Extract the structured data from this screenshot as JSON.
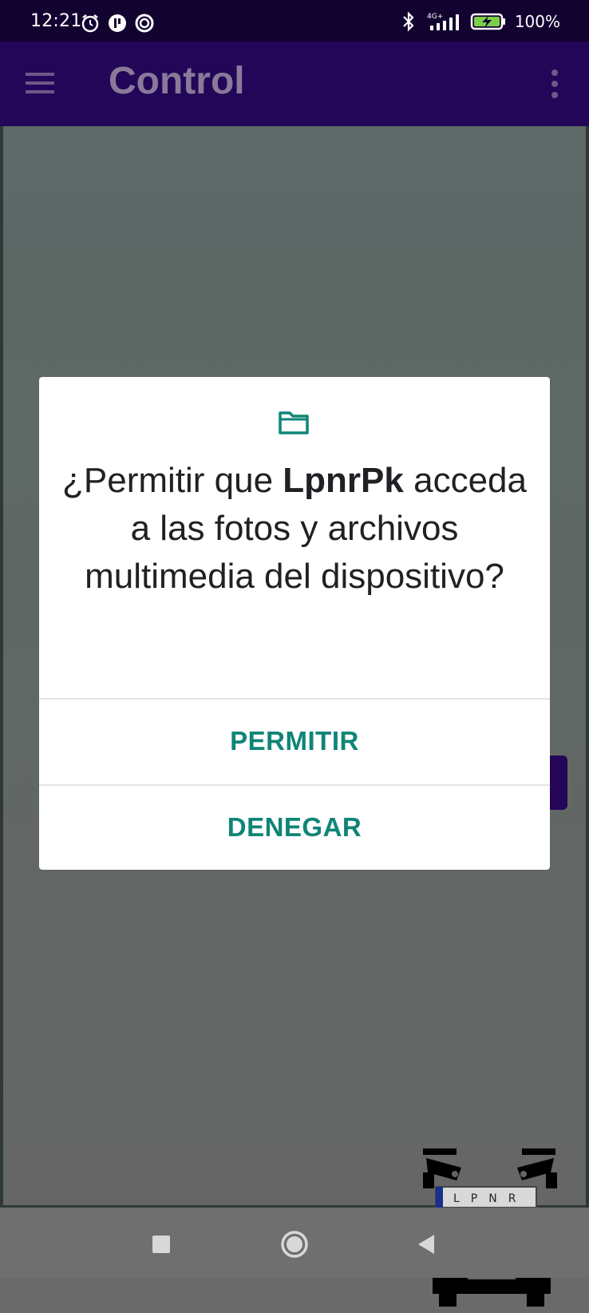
{
  "status_bar": {
    "time": "12:21",
    "battery_text": "100%",
    "network_label": "4G+",
    "icons": [
      "alarm-icon",
      "app-notification-icon",
      "focus-ring-icon",
      "bluetooth-icon",
      "signal-icon",
      "battery-charging-icon"
    ]
  },
  "app_bar": {
    "title": "Control",
    "menu_icon": "hamburger-menu-icon",
    "overflow_icon": "more-vert-icon"
  },
  "dialog": {
    "icon": "folder-icon",
    "message_prefix": "¿Permitir que ",
    "app_name": "LpnrPk",
    "message_suffix": " acceda a las fotos y archivos multimedia del dispositivo?",
    "allow_label": "PERMITIR",
    "deny_label": "DENEGAR"
  },
  "illustration": {
    "plate_text": "LPNR"
  },
  "nav_bar": {
    "recents": "recents-square-icon",
    "home": "home-circle-icon",
    "back": "back-triangle-icon"
  },
  "colors": {
    "status_bar": "#120230",
    "app_bar": "#240659",
    "accent_teal": "#0f8577",
    "dialog_text": "#202124"
  }
}
